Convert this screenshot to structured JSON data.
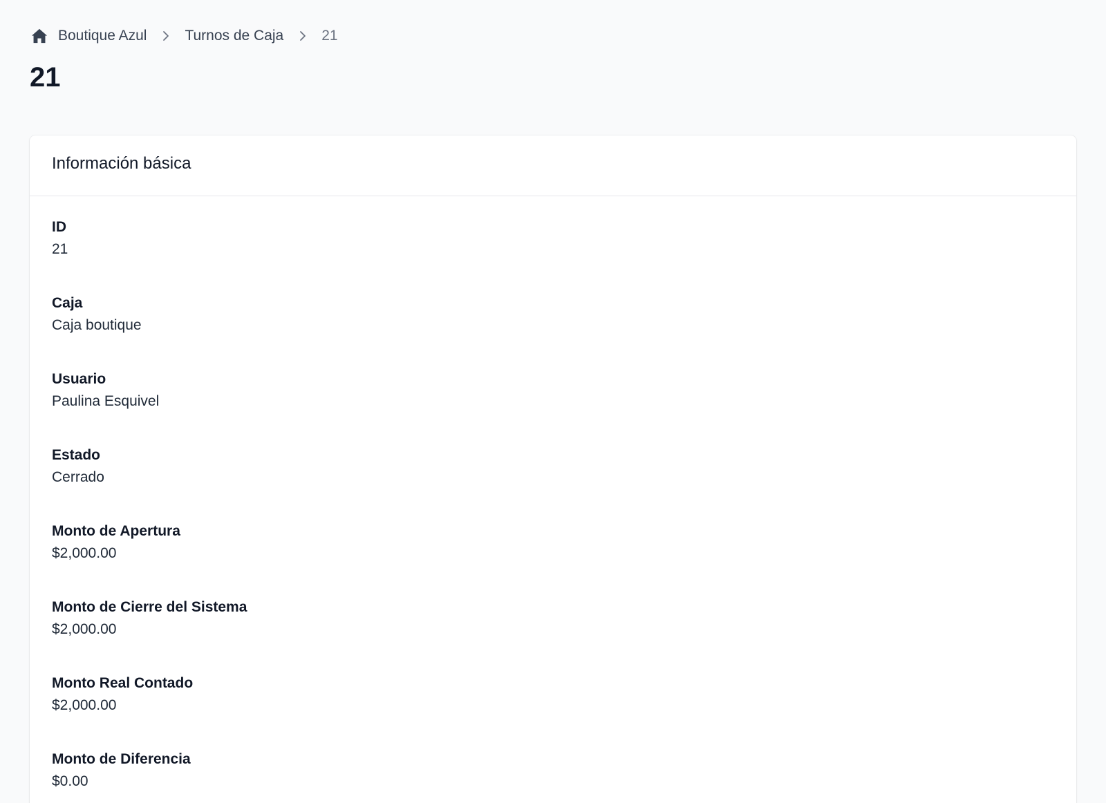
{
  "breadcrumb": {
    "home_icon": "home-icon",
    "items": [
      "Boutique Azul",
      "Turnos de Caja"
    ],
    "current": "21",
    "separator_icon": "chevron-right-icon"
  },
  "page": {
    "title": "21"
  },
  "card": {
    "title": "Información básica",
    "fields": [
      {
        "label": "ID",
        "value": "21"
      },
      {
        "label": "Caja",
        "value": "Caja boutique"
      },
      {
        "label": "Usuario",
        "value": "Paulina Esquivel"
      },
      {
        "label": "Estado",
        "value": "Cerrado"
      },
      {
        "label": "Monto de Apertura",
        "value": "$2,000.00"
      },
      {
        "label": "Monto de Cierre del Sistema",
        "value": "$2,000.00"
      },
      {
        "label": "Monto Real Contado",
        "value": "$2,000.00"
      },
      {
        "label": "Monto de Diferencia",
        "value": "$0.00"
      }
    ]
  },
  "colors": {
    "background": "#f9fafb",
    "card": "#ffffff",
    "text": "#111827",
    "muted": "#6b7280"
  }
}
